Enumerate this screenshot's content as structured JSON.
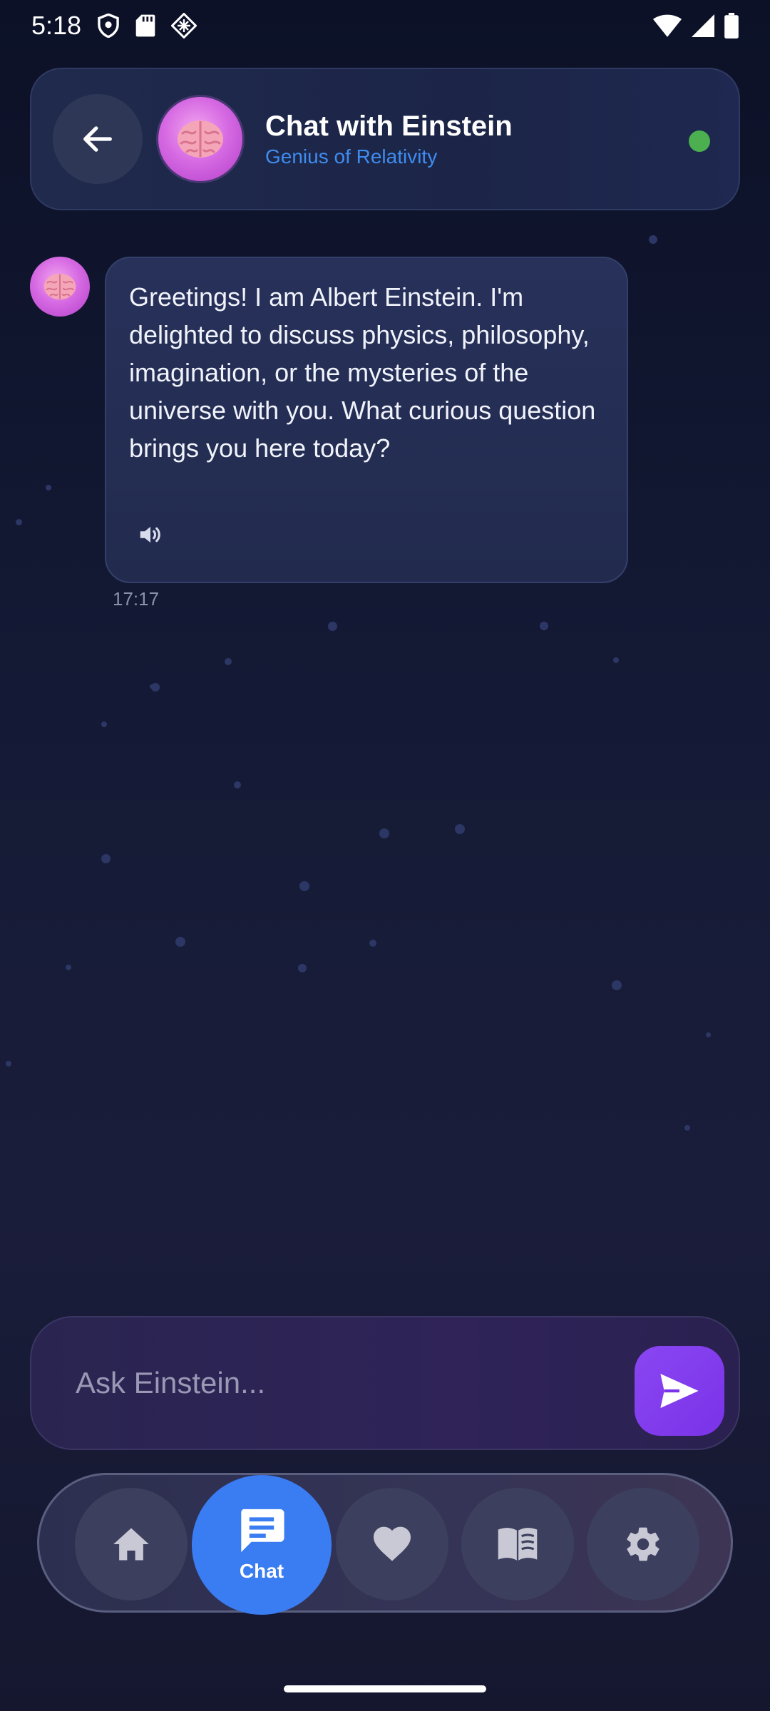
{
  "status_bar": {
    "time": "5:18",
    "left_icons": [
      "shield-icon",
      "sd-card-icon",
      "diamond-icon"
    ],
    "right_icons": [
      "wifi-icon",
      "signal-icon",
      "battery-icon"
    ]
  },
  "header": {
    "title": "Chat with Einstein",
    "subtitle": "Genius of Relativity",
    "avatar_icon": "brain-icon",
    "online": true
  },
  "messages": [
    {
      "sender": "Einstein",
      "avatar_icon": "brain-icon",
      "text": "Greetings! I am Albert Einstein. I'm delighted to discuss physics, philosophy, imagination, or the mysteries of the universe with you. What curious question brings you here today?",
      "time": "17:17",
      "action_icon": "speaker-icon"
    }
  ],
  "input": {
    "placeholder": "Ask Einstein...",
    "value": ""
  },
  "nav": {
    "items": [
      {
        "icon": "home-icon",
        "label": "",
        "active": false
      },
      {
        "icon": "chat-icon",
        "label": "Chat",
        "active": true
      },
      {
        "icon": "heart-icon",
        "label": "",
        "active": false
      },
      {
        "icon": "book-icon",
        "label": "",
        "active": false
      },
      {
        "icon": "settings-icon",
        "label": "",
        "active": false
      }
    ]
  },
  "colors": {
    "accent_blue": "#3a7cf2",
    "send_purple": "#7a33e8",
    "online_green": "#4caf50",
    "subtitle_blue": "#3f8cf0"
  }
}
